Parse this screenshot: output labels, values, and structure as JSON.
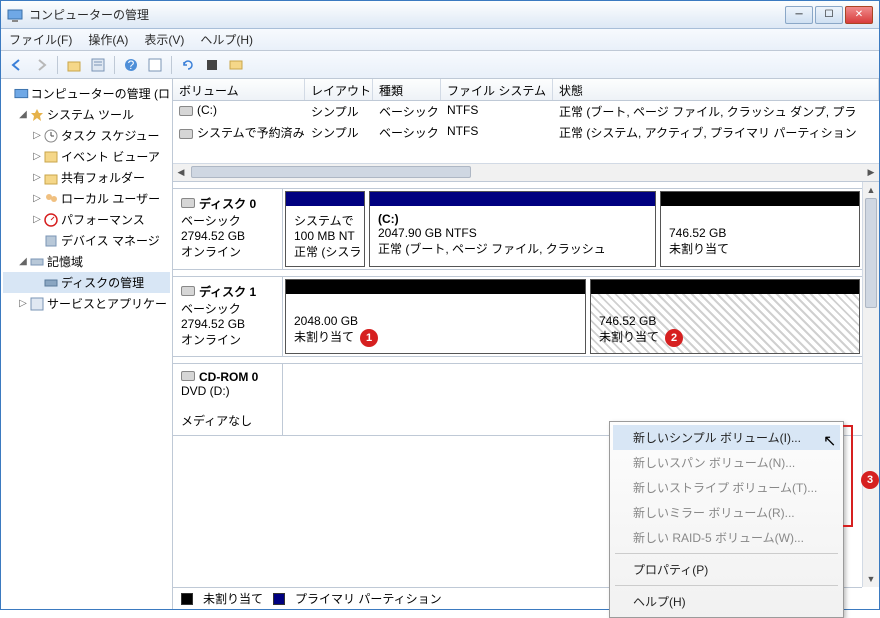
{
  "window": {
    "title": "コンピューターの管理"
  },
  "menubar": {
    "file": "ファイル(F)",
    "action": "操作(A)",
    "view": "表示(V)",
    "help": "ヘルプ(H)"
  },
  "tree": {
    "root": "コンピューターの管理 (ロ",
    "systemTools": "システム ツール",
    "taskScheduler": "タスク スケジュー",
    "eventViewer": "イベント ビューア",
    "sharedFolders": "共有フォルダー",
    "localUsers": "ローカル ユーザー",
    "performance": "パフォーマンス",
    "deviceManager": "デバイス マネージ",
    "storage": "記憶域",
    "diskManagement": "ディスクの管理",
    "servicesApps": "サービスとアプリケー"
  },
  "list": {
    "headers": {
      "volume": "ボリューム",
      "layout": "レイアウト",
      "type": "種類",
      "filesystem": "ファイル システム",
      "status": "状態"
    },
    "rows": [
      {
        "volume": "(C:)",
        "layout": "シンプル",
        "type": "ベーシック",
        "filesystem": "NTFS",
        "status": "正常 (ブート, ページ ファイル, クラッシュ ダンプ, プラ"
      },
      {
        "volume": "システムで予約済み",
        "layout": "シンプル",
        "type": "ベーシック",
        "filesystem": "NTFS",
        "status": "正常 (システム, アクティブ, プライマリ パーティション"
      }
    ]
  },
  "disks": [
    {
      "name": "ディスク 0",
      "type": "ベーシック",
      "size": "2794.52 GB",
      "status": "オンライン",
      "parts": [
        {
          "label": "システムで",
          "size": "100 MB NT",
          "status": "正常 (シスラ"
        },
        {
          "label": "(C:)",
          "size": "2047.90 GB NTFS",
          "status": "正常 (ブート, ページ ファイル, クラッシュ"
        },
        {
          "label": "",
          "size": "746.52 GB",
          "status": "未割り当て"
        }
      ]
    },
    {
      "name": "ディスク 1",
      "type": "ベーシック",
      "size": "2794.52 GB",
      "status": "オンライン",
      "parts": [
        {
          "label": "",
          "size": "2048.00 GB",
          "status": "未割り当て"
        },
        {
          "label": "",
          "size": "746.52 GB",
          "status": "未割り当て"
        }
      ]
    },
    {
      "name": "CD-ROM 0",
      "type": "DVD (D:)",
      "size": "",
      "status": "メディアなし",
      "parts": []
    }
  ],
  "legend": {
    "unallocated": "未割り当て",
    "primary": "プライマリ パーティション"
  },
  "contextMenu": {
    "items": [
      "新しいシンプル ボリューム(I)...",
      "新しいスパン ボリューム(N)...",
      "新しいストライプ ボリューム(T)...",
      "新しいミラー ボリューム(R)...",
      "新しい RAID-5 ボリューム(W)...",
      "プロパティ(P)",
      "ヘルプ(H)"
    ]
  },
  "markers": [
    "1",
    "2",
    "3"
  ]
}
